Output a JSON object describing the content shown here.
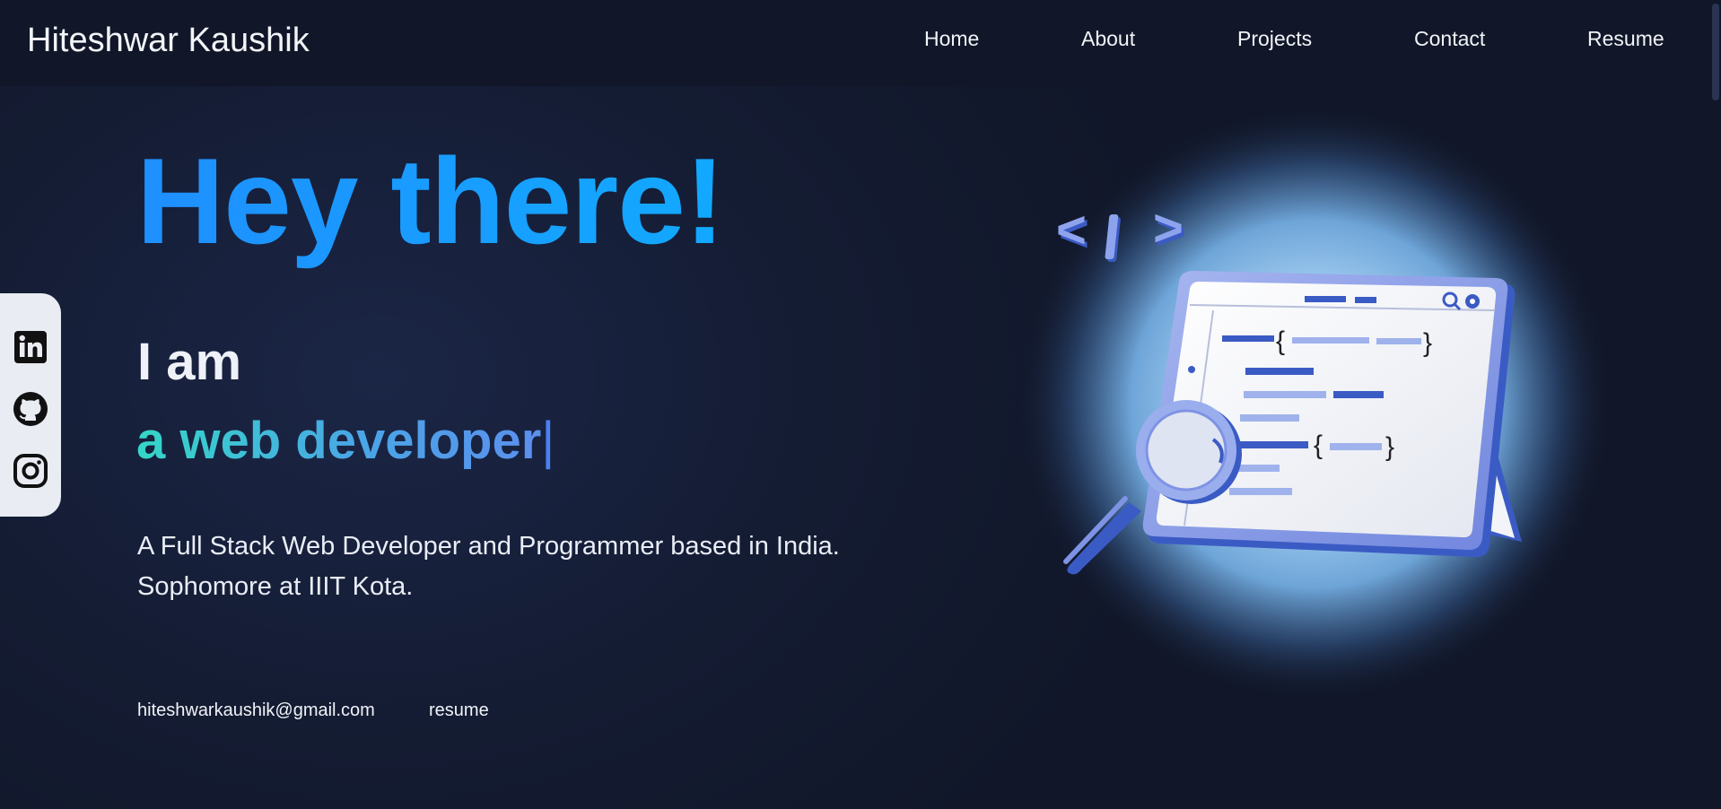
{
  "nav": {
    "brand": "Hiteshwar Kaushik",
    "links": [
      "Home",
      "About",
      "Projects",
      "Contact",
      "Resume"
    ]
  },
  "social": {
    "icons": [
      "linkedin-icon",
      "github-icon",
      "instagram-icon"
    ]
  },
  "hero": {
    "greeting": "Hey there!",
    "intro": "I am",
    "role": "a web developer",
    "cursor": "|",
    "bio_line1": "A Full Stack Web Developer and Programmer based in India.",
    "bio_line2": "Sophomore at IIIT Kota.",
    "email": "hiteshwarkaushik@gmail.com",
    "resume_link": "resume"
  },
  "illustration": {
    "code_tag_left": "<",
    "code_tag_mid": "|",
    "code_tag_right": ">",
    "alert_symbol": "!"
  },
  "colors": {
    "background": "#131a2e",
    "accent_blue": "#1f8fff",
    "accent_teal": "#34d7c7",
    "illustration_blue": "#3b5bc4"
  }
}
